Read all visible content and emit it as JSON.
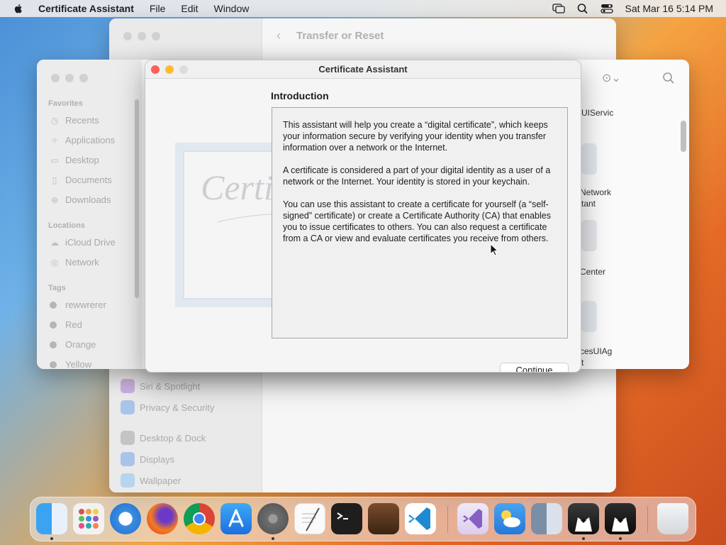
{
  "menubar": {
    "app_name": "Certificate Assistant",
    "menus": [
      "File",
      "Edit",
      "Window"
    ],
    "datetime": "Sat Mar 16  5:14 PM"
  },
  "settings_window": {
    "title": "Transfer or Reset",
    "sidebar_items": [
      "Siri & Spotlight",
      "Privacy & Security",
      "Desktop & Dock",
      "Displays",
      "Wallpaper"
    ]
  },
  "finder": {
    "favorites_label": "Favorites",
    "favorites": [
      "Recents",
      "Applications",
      "Desktop",
      "Documents",
      "Downloads"
    ],
    "locations_label": "Locations",
    "locations": [
      "iCloud Drive",
      "Network"
    ],
    "tags_label": "Tags",
    "tags": [
      "rewwrerer",
      "Red",
      "Orange",
      "Yellow"
    ],
    "file_labels": [
      "UIServic",
      "Network",
      "tant",
      "Center",
      "cesUIAg",
      "t"
    ]
  },
  "dialog": {
    "title": "Certificate Assistant",
    "heading": "Introduction",
    "paragraphs": [
      "This assistant will help you create a “digital certificate”, which keeps your information secure by verifying your identity when you transfer information over a network or the Internet.",
      "A certificate is considered a part of your digital identity as a user of a network or the Internet. Your identity is stored in your keychain.",
      "You can use this assistant to create a certificate for yourself (a “self-signed” certificate) or create a Certificate Authority (CA) that enables you to issue certificates to others. You can also request a certificate from a CA or view and evaluate certificates you receive from others."
    ],
    "continue_label": "Continue",
    "artwork_text": "Certificate"
  },
  "dock": {
    "apps": [
      "finder-icon",
      "launchpad-icon",
      "safari-icon",
      "firefox-icon",
      "chrome-icon",
      "app-store-icon",
      "system-settings-icon",
      "textedit-icon",
      "terminal-icon",
      "instruments-icon",
      "vscode-icon",
      "visual-studio-icon",
      "weather-icon",
      "migration-icon",
      "bartender-icon",
      "bartender-alt-icon",
      "trash-icon"
    ]
  }
}
